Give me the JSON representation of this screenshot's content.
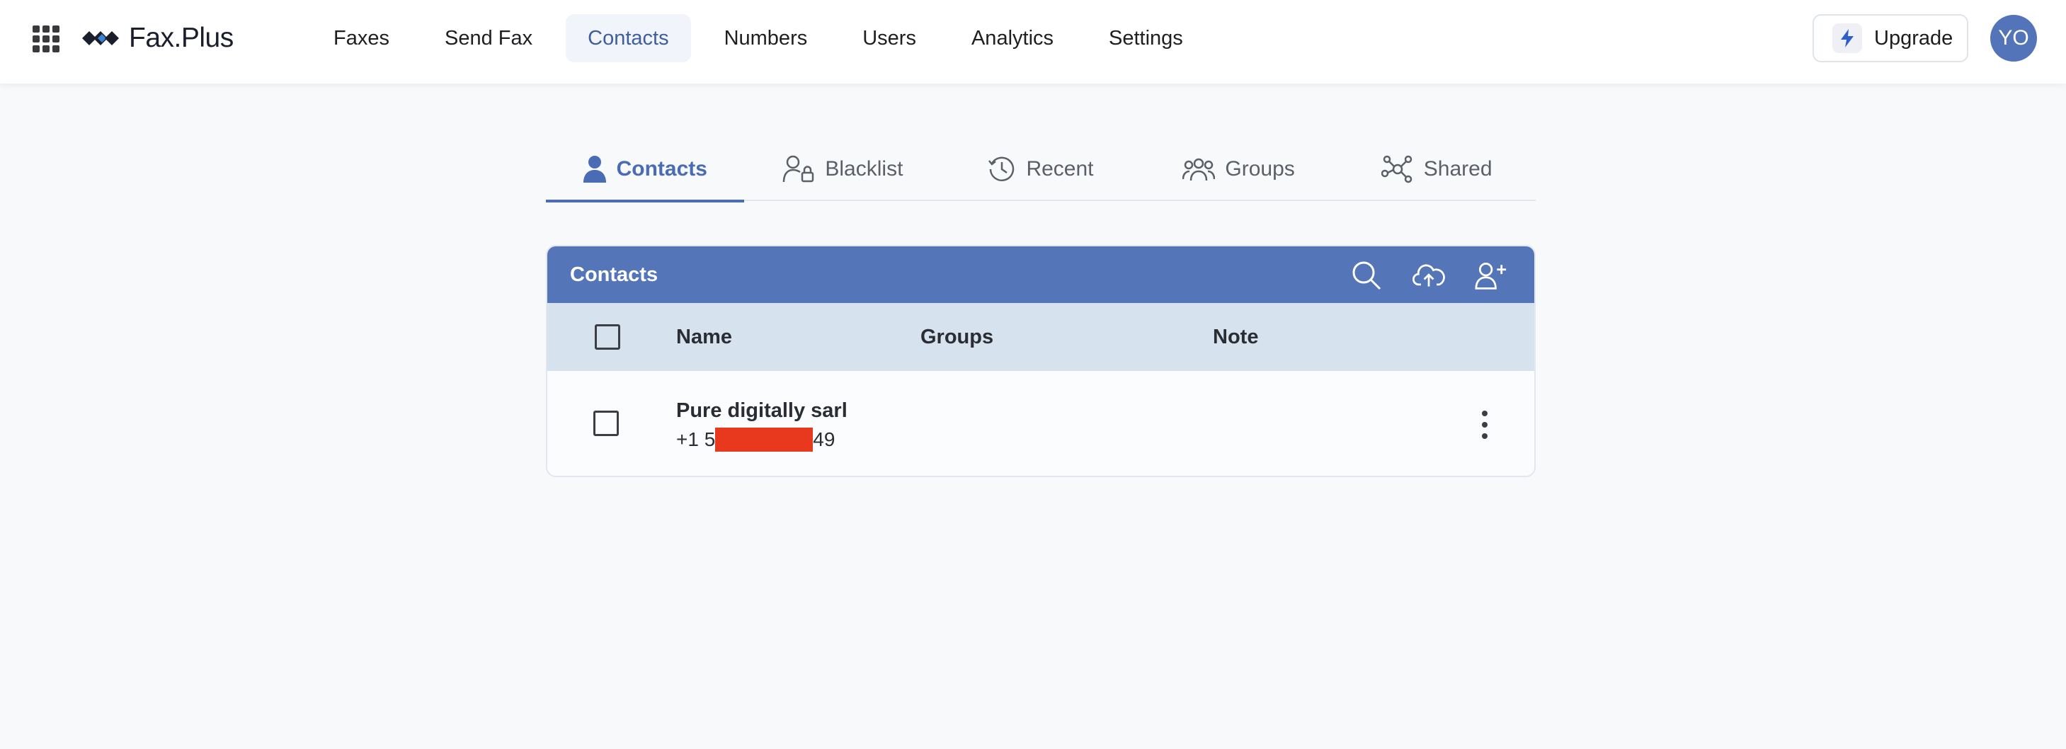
{
  "brand": {
    "name": "Fax.Plus"
  },
  "nav": {
    "items": [
      {
        "label": "Faxes",
        "active": false
      },
      {
        "label": "Send Fax",
        "active": false
      },
      {
        "label": "Contacts",
        "active": true
      },
      {
        "label": "Numbers",
        "active": false
      },
      {
        "label": "Users",
        "active": false
      },
      {
        "label": "Analytics",
        "active": false
      },
      {
        "label": "Settings",
        "active": false
      }
    ]
  },
  "header": {
    "upgrade_label": "Upgrade",
    "avatar_initials": "YO"
  },
  "tabs": [
    {
      "label": "Contacts",
      "icon": "person-icon",
      "active": true
    },
    {
      "label": "Blacklist",
      "icon": "person-lock-icon",
      "active": false
    },
    {
      "label": "Recent",
      "icon": "history-icon",
      "active": false
    },
    {
      "label": "Groups",
      "icon": "group-icon",
      "active": false
    },
    {
      "label": "Shared",
      "icon": "share-network-icon",
      "active": false
    }
  ],
  "contacts_card": {
    "title": "Contacts",
    "actions": [
      "search-icon",
      "cloud-upload-icon",
      "add-person-icon"
    ],
    "columns": {
      "name": "Name",
      "groups": "Groups",
      "note": "Note"
    },
    "rows": [
      {
        "name": "Pure digitally sarl",
        "phone_prefix": "+1 5",
        "phone_suffix": "49",
        "groups": "",
        "note": ""
      }
    ]
  },
  "colors": {
    "accent": "#4a6cb4",
    "header_bar": "#5475b8",
    "table_head": "#d6e2ee",
    "redaction": "#e8391e"
  }
}
